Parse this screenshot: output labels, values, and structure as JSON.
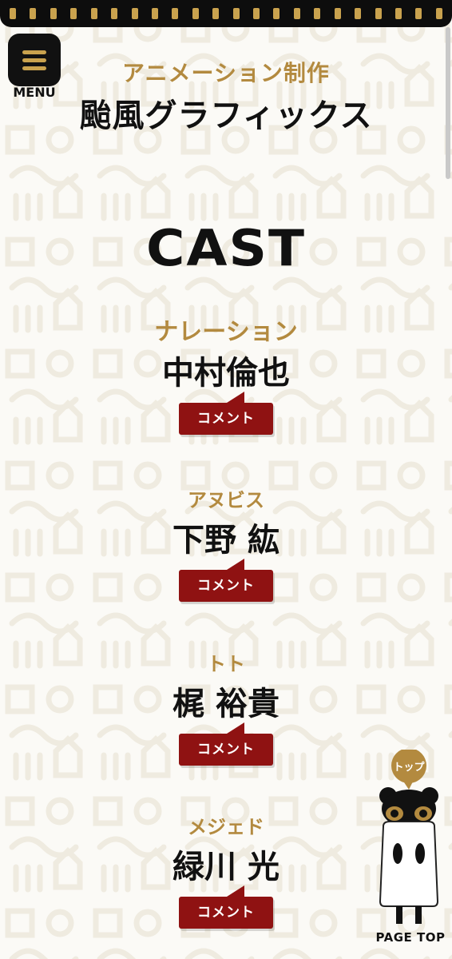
{
  "header": {
    "menu_label": "MENU",
    "site_sub": "アニメーション制作",
    "site_title": "颱風グラフィックス"
  },
  "cast": {
    "heading": "CAST",
    "entries": [
      {
        "role": "ナレーション",
        "actor": "中村倫也",
        "comment_label": "コメント"
      },
      {
        "role": "アヌビス",
        "actor": "下野 紘",
        "comment_label": "コメント"
      },
      {
        "role": "トト",
        "actor": "梶 裕貴",
        "comment_label": "コメント"
      },
      {
        "role": "メジェド",
        "actor": "緑川 光",
        "comment_label": "コメント"
      }
    ]
  },
  "page_top": {
    "bubble_label": "トップ",
    "label": "PAGE TOP"
  },
  "colors": {
    "accent_gold": "#b38a3f",
    "comment_red": "#8f1212",
    "dark": "#111111"
  }
}
